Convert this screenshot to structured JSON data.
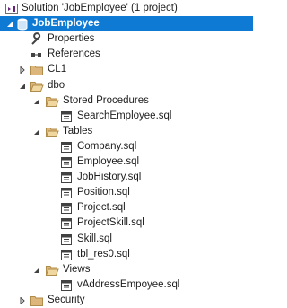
{
  "solution_explorer": {
    "solution_label": "Solution 'JobEmployee' (1 project)",
    "project_label": "JobEmployee",
    "items": {
      "properties": "Properties",
      "references": "References",
      "cl1": "CL1",
      "dbo": "dbo",
      "stored_procedures": "Stored Procedures",
      "search_employee": "SearchEmployee.sql",
      "tables": "Tables",
      "company": "Company.sql",
      "employee": "Employee.sql",
      "job_history": "JobHistory.sql",
      "position": "Position.sql",
      "project": "Project.sql",
      "project_skill": "ProjectSkill.sql",
      "skill": "Skill.sql",
      "tbl_res0": "tbl_res0.sql",
      "views": "Views",
      "v_address": "vAddressEmpoyee.sql",
      "security": "Security"
    }
  },
  "colors": {
    "selection": "#0e7ad4",
    "folder": "#dcb67a",
    "text": "#1e1e1e"
  }
}
